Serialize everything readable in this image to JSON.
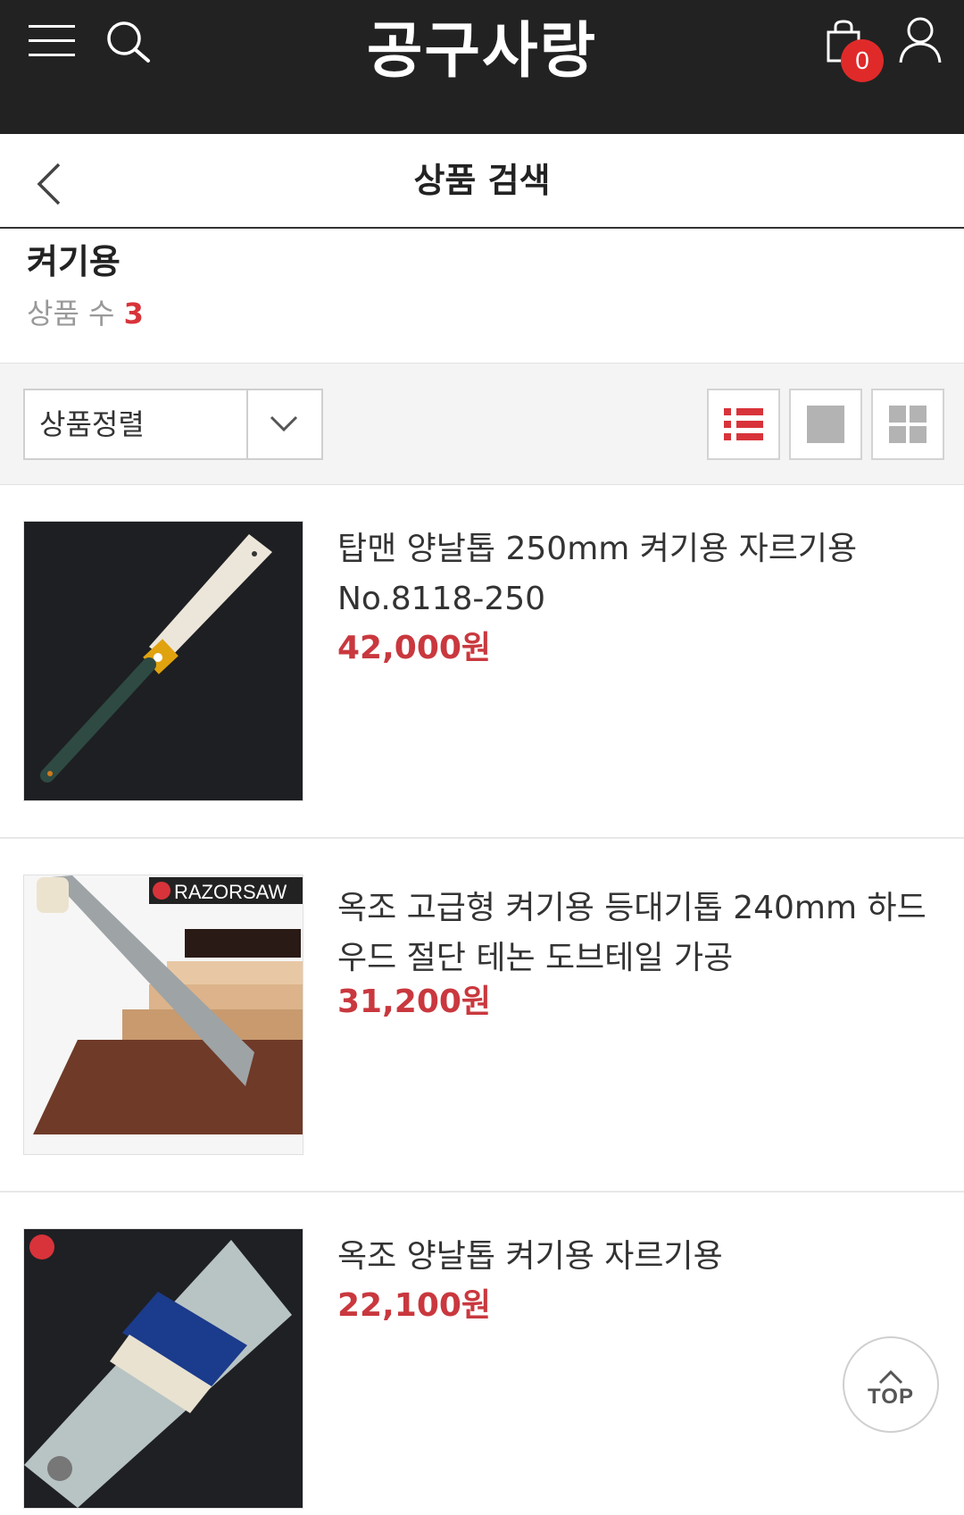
{
  "header": {
    "logo": "공구사랑",
    "cart_count": "0",
    "icons": [
      "menu-icon",
      "search-icon",
      "cart-icon",
      "user-icon"
    ]
  },
  "subheader": {
    "title": "상품 검색",
    "back_icon": "chevron-left-icon"
  },
  "search": {
    "keyword": "켜기용",
    "count_label": "상품 수",
    "count": "3"
  },
  "toolbar": {
    "sort_label": "상품정렬",
    "views": [
      "list-view-icon",
      "single-grid-view-icon",
      "four-grid-view-icon"
    ],
    "active_view": "list"
  },
  "products": [
    {
      "name": "탑맨 양날톱 250mm 켜기용 자르기용 No.8118-250",
      "price": "42,000원"
    },
    {
      "name": "옥조 고급형 켜기용 등대기톱 240mm 하드우드 절단 테논 도브테일 가공",
      "price": "31,200원"
    },
    {
      "name": "옥조 양날톱 켜기용 자르기용",
      "price": "22,100원"
    }
  ],
  "thumb_text": {
    "razorsaw_brand": "RAZORSAW"
  },
  "scroll_top": {
    "label": "TOP"
  },
  "colors": {
    "header_bg": "#222222",
    "accent_red": "#c9383e",
    "badge_red": "#e02a2a"
  }
}
